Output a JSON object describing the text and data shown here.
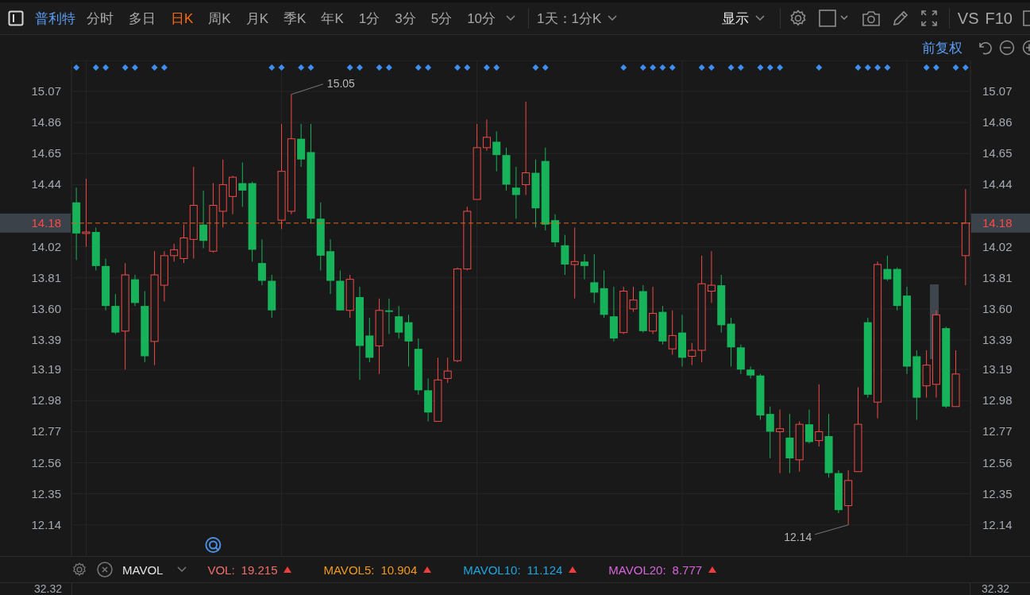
{
  "toolbar": {
    "stock_name": "普利特",
    "periods": [
      {
        "label": "分时",
        "selected": false
      },
      {
        "label": "多日",
        "selected": false
      },
      {
        "label": "日K",
        "selected": true
      },
      {
        "label": "周K",
        "selected": false
      },
      {
        "label": "月K",
        "selected": false
      },
      {
        "label": "季K",
        "selected": false
      },
      {
        "label": "年K",
        "selected": false
      },
      {
        "label": "1分",
        "selected": false
      },
      {
        "label": "3分",
        "selected": false
      },
      {
        "label": "5分",
        "selected": false
      },
      {
        "label": "10分",
        "selected": false,
        "dropdown": true
      }
    ],
    "range_select": "1天：1分K",
    "display_menu": "显示",
    "compare": "VS",
    "f10": "F10"
  },
  "chart_header": {
    "adjust": "前复权"
  },
  "price_chart": {
    "chart_data": {
      "type": "candlestick",
      "ylim": [
        11.94,
        15.28
      ],
      "grid": true,
      "categories": [
        null,
        null,
        null,
        null,
        null,
        null,
        null,
        null,
        null,
        null,
        null,
        null,
        null,
        null,
        null,
        null,
        null,
        null,
        null,
        null,
        null,
        null,
        null,
        null,
        null,
        null,
        null,
        null,
        null,
        null,
        null,
        null,
        null,
        null,
        null,
        null,
        null,
        null,
        null,
        null,
        null,
        null,
        null,
        null,
        null,
        null,
        null,
        null,
        null,
        null,
        null,
        null,
        null,
        null,
        null,
        null,
        null,
        null,
        null,
        null,
        null,
        null,
        null,
        null,
        null,
        null,
        null,
        null,
        null,
        null,
        null,
        null,
        null,
        null,
        null,
        null,
        null,
        null,
        null,
        null,
        null,
        null,
        null,
        null,
        null,
        null,
        null,
        null,
        null,
        null,
        null,
        null
      ],
      "yticks": [
        {
          "value": 15.07,
          "label": "15.07"
        },
        {
          "value": 14.86,
          "label": "14.86"
        },
        {
          "value": 14.65,
          "label": "14.65"
        },
        {
          "value": 14.44,
          "label": "14.44"
        },
        {
          "value": 14.02,
          "label": "14.02"
        },
        {
          "value": 13.81,
          "label": "13.81"
        },
        {
          "value": 13.6,
          "label": "13.60"
        },
        {
          "value": 13.39,
          "label": "13.39"
        },
        {
          "value": 13.19,
          "label": "13.19"
        },
        {
          "value": 12.98,
          "label": "12.98"
        },
        {
          "value": 12.77,
          "label": "12.77"
        },
        {
          "value": 12.56,
          "label": "12.56"
        },
        {
          "value": 12.35,
          "label": "12.35"
        },
        {
          "value": 12.14,
          "label": "12.14"
        }
      ],
      "ohlc": [
        [
          14.32,
          14.42,
          13.93,
          14.11
        ],
        [
          14.11,
          14.48,
          14.02,
          14.12
        ],
        [
          14.12,
          14.15,
          13.86,
          13.89
        ],
        [
          13.89,
          13.94,
          13.59,
          13.62
        ],
        [
          13.62,
          13.7,
          13.43,
          13.44
        ],
        [
          13.45,
          13.91,
          13.19,
          13.83
        ],
        [
          13.8,
          13.83,
          13.62,
          13.64
        ],
        [
          13.62,
          13.72,
          13.24,
          13.28
        ],
        [
          13.38,
          13.99,
          13.22,
          13.83
        ],
        [
          13.76,
          13.99,
          13.65,
          13.96
        ],
        [
          13.96,
          14.04,
          13.92,
          14.0
        ],
        [
          13.94,
          14.17,
          13.91,
          14.08
        ],
        [
          14.07,
          14.56,
          13.94,
          14.3
        ],
        [
          14.17,
          14.4,
          14.01,
          14.06
        ],
        [
          13.99,
          14.45,
          13.98,
          14.3
        ],
        [
          14.26,
          14.61,
          14.15,
          14.44
        ],
        [
          14.36,
          14.5,
          14.24,
          14.49
        ],
        [
          14.45,
          14.59,
          14.29,
          14.4
        ],
        [
          14.45,
          14.46,
          13.92,
          14.0
        ],
        [
          13.91,
          14.07,
          13.76,
          13.79
        ],
        [
          13.79,
          13.83,
          13.54,
          13.59
        ],
        [
          14.2,
          14.85,
          14.14,
          14.53
        ],
        [
          14.26,
          15.05,
          14.24,
          14.75
        ],
        [
          14.75,
          14.85,
          14.56,
          14.61
        ],
        [
          14.66,
          14.85,
          14.18,
          14.21
        ],
        [
          14.21,
          14.32,
          13.86,
          13.96
        ],
        [
          13.99,
          14.07,
          13.7,
          13.79
        ],
        [
          13.79,
          13.86,
          13.59,
          13.59
        ],
        [
          13.59,
          13.83,
          13.54,
          13.8
        ],
        [
          13.68,
          13.75,
          13.12,
          13.35
        ],
        [
          13.42,
          13.54,
          13.24,
          13.27
        ],
        [
          13.35,
          13.67,
          13.16,
          13.59
        ],
        [
          13.59,
          13.67,
          13.43,
          13.58
        ],
        [
          13.55,
          13.62,
          13.4,
          13.44
        ],
        [
          13.51,
          13.56,
          13.21,
          13.38
        ],
        [
          13.33,
          13.4,
          13.02,
          13.05
        ],
        [
          13.05,
          13.13,
          12.84,
          12.9
        ],
        [
          12.84,
          13.27,
          12.84,
          13.12
        ],
        [
          13.13,
          13.27,
          13.1,
          13.18
        ],
        [
          13.25,
          13.88,
          13.24,
          13.87
        ],
        [
          13.87,
          14.29,
          13.86,
          14.26
        ],
        [
          14.34,
          14.85,
          14.34,
          14.69
        ],
        [
          14.69,
          14.88,
          14.67,
          14.76
        ],
        [
          14.73,
          14.8,
          14.53,
          14.64
        ],
        [
          14.64,
          14.69,
          14.4,
          14.44
        ],
        [
          14.42,
          14.56,
          14.21,
          14.37
        ],
        [
          14.44,
          15.0,
          14.37,
          14.52
        ],
        [
          14.52,
          14.61,
          14.15,
          14.28
        ],
        [
          14.6,
          14.69,
          14.13,
          14.17
        ],
        [
          14.2,
          14.24,
          14.02,
          14.05
        ],
        [
          14.03,
          14.1,
          13.83,
          13.9
        ],
        [
          13.9,
          14.15,
          13.67,
          13.92
        ],
        [
          13.92,
          13.97,
          13.8,
          13.89
        ],
        [
          13.78,
          13.97,
          13.64,
          13.71
        ],
        [
          13.74,
          13.86,
          13.54,
          13.56
        ],
        [
          13.55,
          13.75,
          13.38,
          13.4
        ],
        [
          13.44,
          13.75,
          13.43,
          13.72
        ],
        [
          13.6,
          13.75,
          13.58,
          13.66
        ],
        [
          13.72,
          13.76,
          13.44,
          13.45
        ],
        [
          13.45,
          13.75,
          13.43,
          13.57
        ],
        [
          13.58,
          13.62,
          13.36,
          13.38
        ],
        [
          13.33,
          13.59,
          13.29,
          13.42
        ],
        [
          13.44,
          13.56,
          13.21,
          13.27
        ],
        [
          13.28,
          13.37,
          13.22,
          13.32
        ],
        [
          13.32,
          13.96,
          13.24,
          13.77
        ],
        [
          13.72,
          13.99,
          13.64,
          13.76
        ],
        [
          13.76,
          13.83,
          13.44,
          13.49
        ],
        [
          13.5,
          13.54,
          13.21,
          13.34
        ],
        [
          13.34,
          13.36,
          13.16,
          13.19
        ],
        [
          13.19,
          13.21,
          13.13,
          13.15
        ],
        [
          13.15,
          13.16,
          12.85,
          12.88
        ],
        [
          12.89,
          12.94,
          12.59,
          12.77
        ],
        [
          12.77,
          12.92,
          12.49,
          12.79
        ],
        [
          12.73,
          12.89,
          12.49,
          12.59
        ],
        [
          12.58,
          12.84,
          12.5,
          12.82
        ],
        [
          12.82,
          12.92,
          12.69,
          12.7
        ],
        [
          12.71,
          13.09,
          12.67,
          12.77
        ],
        [
          12.74,
          12.89,
          12.46,
          12.49
        ],
        [
          12.49,
          12.51,
          12.22,
          12.24
        ],
        [
          12.27,
          12.51,
          12.14,
          12.44
        ],
        [
          12.5,
          13.07,
          12.5,
          12.82
        ],
        [
          13.51,
          13.54,
          13.0,
          13.02
        ],
        [
          12.97,
          13.92,
          12.86,
          13.9
        ],
        [
          13.87,
          13.96,
          13.79,
          13.8
        ],
        [
          13.87,
          13.88,
          13.59,
          13.62
        ],
        [
          13.69,
          13.75,
          13.16,
          13.21
        ],
        [
          13.28,
          13.32,
          12.85,
          13.0
        ],
        [
          13.08,
          13.32,
          13.0,
          13.22
        ],
        [
          13.09,
          13.59,
          13.0,
          13.56
        ],
        [
          13.47,
          13.48,
          12.93,
          12.94
        ],
        [
          12.94,
          13.32,
          12.94,
          13.16
        ],
        [
          13.96,
          14.41,
          13.76,
          14.18
        ]
      ],
      "annotations": [
        "15.05",
        "12.14"
      ],
      "ref_lines": [
        {
          "axis": "y",
          "value": 14.18,
          "label": "14.18"
        }
      ]
    },
    "right_price_tag": "14.18",
    "right_axis_labels": [
      "15.07",
      "14.86",
      "14.65",
      "14.44",
      "14.02",
      "13.81",
      "13.60",
      "13.39",
      "13.19",
      "12.98",
      "12.77",
      "12.56",
      "12.35",
      "12.14"
    ]
  },
  "indicator": {
    "name": "MAVOL",
    "values": [
      {
        "label": "VOL:",
        "value": "19.215",
        "color": "#f26d6d",
        "rising": true
      },
      {
        "label": "MAVOL5:",
        "value": "10.904",
        "color": "#f29a1f",
        "rising": true
      },
      {
        "label": "MAVOL10:",
        "value": "11.124",
        "color": "#1ea7e1",
        "rising": true
      },
      {
        "label": "MAVOL20:",
        "value": "8.777",
        "color": "#d864dc",
        "rising": true
      }
    ]
  },
  "volume_axis": {
    "left_label": "32.32",
    "right_label": "32.32"
  }
}
